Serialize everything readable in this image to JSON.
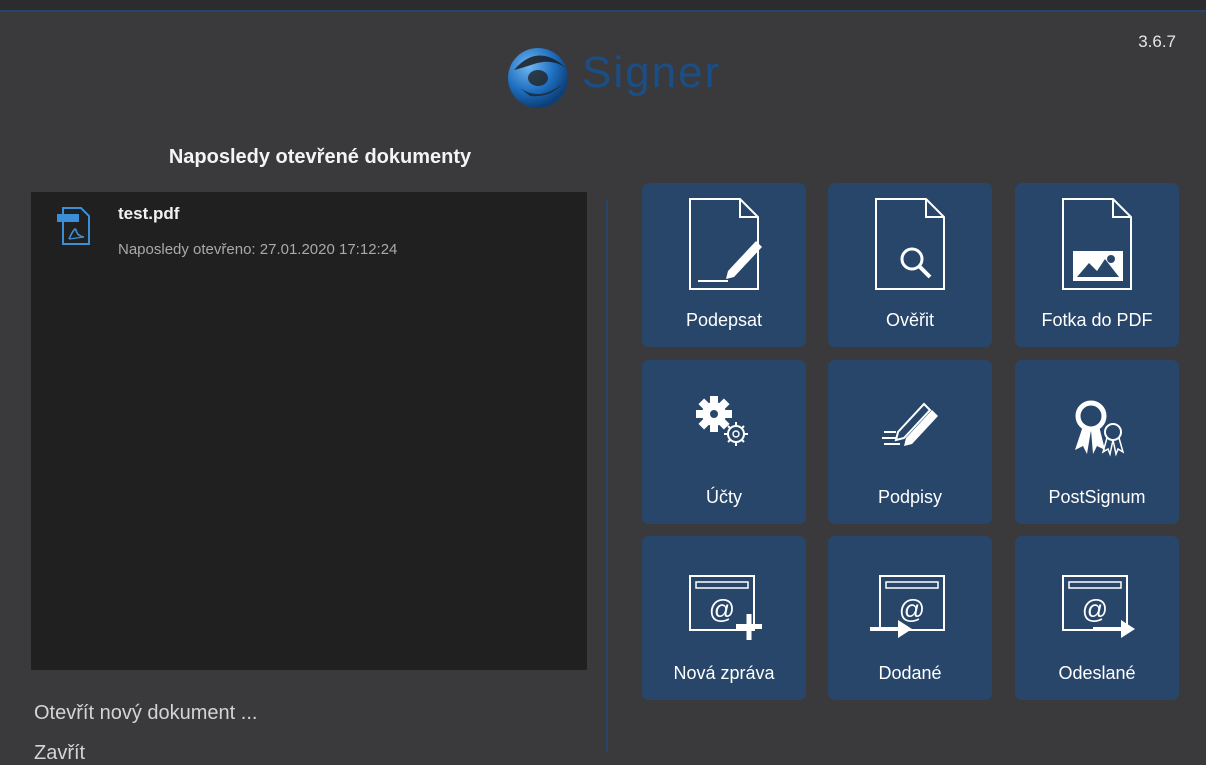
{
  "app": {
    "version": "3.6.7",
    "logo_text": "Signer"
  },
  "recent": {
    "title": "Naposledy otevřené dokumenty",
    "documents": [
      {
        "name": "test.pdf",
        "opened": "Naposledy otevřeno: 27.01.2020 17:12:24",
        "icon": "pdf-icon"
      }
    ]
  },
  "actions": {
    "open_new": "Otevřít nový dokument ...",
    "close": "Zavřít"
  },
  "tiles": [
    {
      "label": "Podepsat",
      "icon": "document-sign-icon"
    },
    {
      "label": "Ověřit",
      "icon": "document-verify-icon"
    },
    {
      "label": "Fotka do PDF",
      "icon": "photo-to-pdf-icon"
    },
    {
      "label": "Účty",
      "icon": "gears-icon"
    },
    {
      "label": "Podpisy",
      "icon": "pens-icon"
    },
    {
      "label": "PostSignum",
      "icon": "award-ribbon-icon"
    },
    {
      "label": "Nová zpráva",
      "icon": "new-message-icon"
    },
    {
      "label": "Dodané",
      "icon": "inbox-icon"
    },
    {
      "label": "Odeslané",
      "icon": "outbox-icon"
    }
  ],
  "colors": {
    "background": "#3a3a3c",
    "panel": "#202021",
    "tile": "#28466a",
    "accent": "#27456b"
  }
}
